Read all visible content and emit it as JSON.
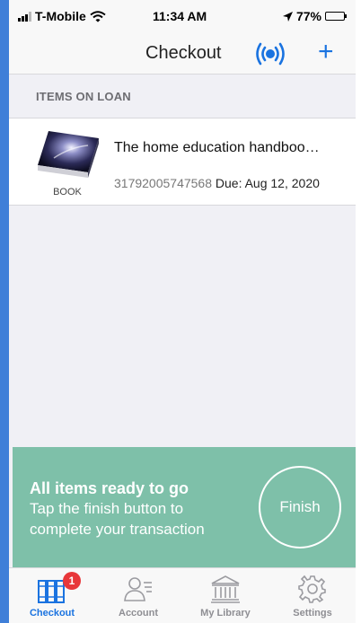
{
  "status_bar": {
    "carrier": "T-Mobile",
    "time": "11:34 AM",
    "battery_text": "77%",
    "icons": [
      "signal-icon",
      "wifi-icon",
      "location-arrow-icon",
      "battery-icon"
    ]
  },
  "nav": {
    "title": "Checkout",
    "icons": [
      "beacon-icon",
      "plus-icon"
    ],
    "plus_label": "+"
  },
  "section": {
    "header": "ITEMS ON LOAN"
  },
  "items": [
    {
      "title": "The home education handboo…",
      "type": "BOOK",
      "barcode": "31792005747568",
      "due": "Due: Aug 12, 2020"
    }
  ],
  "banner": {
    "headline": "All items ready to go",
    "line1": "Tap the finish button to",
    "line2": "complete your transaction",
    "finish_label": "Finish"
  },
  "tabs": [
    {
      "label": "Checkout",
      "icon": "books-icon",
      "badge": "1",
      "active": true
    },
    {
      "label": "Account",
      "icon": "account-icon",
      "active": false
    },
    {
      "label": "My Library",
      "icon": "library-icon",
      "active": false
    },
    {
      "label": "Settings",
      "icon": "gear-icon",
      "active": false
    }
  ],
  "colors": {
    "accent": "#1a73e0",
    "banner": "#7ec0a9",
    "badge": "#e8373a"
  }
}
